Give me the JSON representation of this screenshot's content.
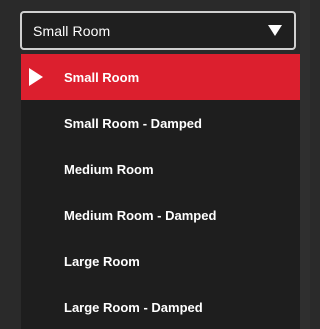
{
  "dropdown": {
    "selected_value": "Small Room",
    "caret_icon": "caret-down-icon",
    "options": [
      {
        "label": "Small Room",
        "selected": true
      },
      {
        "label": "Small Room - Damped",
        "selected": false
      },
      {
        "label": "Medium Room",
        "selected": false
      },
      {
        "label": "Medium Room - Damped",
        "selected": false
      },
      {
        "label": "Large Room",
        "selected": false
      },
      {
        "label": "Large Room - Damped",
        "selected": false
      }
    ]
  },
  "colors": {
    "accent": "#dc1f2e",
    "menu_background": "#1e1e1e",
    "text": "#ffffff"
  }
}
